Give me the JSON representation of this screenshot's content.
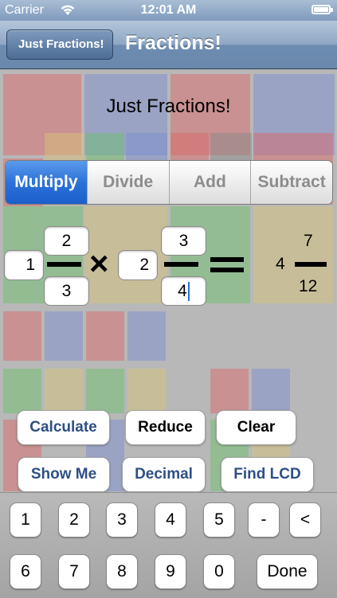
{
  "status": {
    "carrier": "Carrier",
    "time": "12:01 AM"
  },
  "nav": {
    "back_label": "Just Fractions!",
    "title": "Fractions!"
  },
  "heading": "Just Fractions!",
  "operations": [
    "Multiply",
    "Divide",
    "Add",
    "Subtract"
  ],
  "fraction1": {
    "whole": "1",
    "numerator": "2",
    "denominator": "3"
  },
  "fraction2": {
    "whole": "2",
    "numerator": "3",
    "denominator": "4"
  },
  "result": {
    "whole": "4",
    "numerator": "7",
    "denominator": "12"
  },
  "actions": {
    "calculate": "Calculate",
    "reduce": "Reduce",
    "clear": "Clear",
    "show_me": "Show Me",
    "decimal": "Decimal",
    "find_lcd": "Find LCD"
  },
  "keypad": {
    "row1": [
      "1",
      "2",
      "3",
      "4",
      "5",
      "-",
      "<"
    ],
    "row2": [
      "6",
      "7",
      "8",
      "9",
      "0",
      "Done"
    ]
  },
  "colors": {
    "accent": "#2c72d9",
    "button_text": "#2d4f86",
    "nav": "#6d8cb1"
  },
  "icons": {
    "wifi": "wifi-icon",
    "battery": "battery-icon",
    "multiply": "multiply-icon"
  }
}
